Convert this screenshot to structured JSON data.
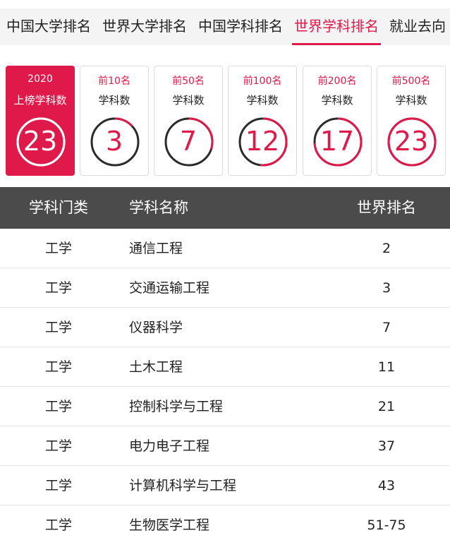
{
  "tabs": [
    {
      "label": "中国大学排名",
      "active": false
    },
    {
      "label": "世界大学排名",
      "active": false
    },
    {
      "label": "中国学科排名",
      "active": false
    },
    {
      "label": "世界学科排名",
      "active": true
    },
    {
      "label": "就业去向",
      "active": false
    }
  ],
  "cards": [
    {
      "line1": "2020",
      "line2": "上榜学科数",
      "value": "23",
      "highlight": true,
      "fraction": 1.0
    },
    {
      "line1": "前10名",
      "line2": "学科数",
      "value": "3",
      "highlight": false,
      "fraction": 0.13
    },
    {
      "line1": "前50名",
      "line2": "学科数",
      "value": "7",
      "highlight": false,
      "fraction": 0.3
    },
    {
      "line1": "前100名",
      "line2": "学科数",
      "value": "12",
      "highlight": false,
      "fraction": 0.52
    },
    {
      "line1": "前200名",
      "line2": "学科数",
      "value": "17",
      "highlight": false,
      "fraction": 0.74
    },
    {
      "line1": "前500名",
      "line2": "学科数",
      "value": "23",
      "highlight": false,
      "fraction": 1.0
    }
  ],
  "table": {
    "headers": [
      "学科门类",
      "学科名称",
      "世界排名"
    ],
    "rows": [
      [
        "工学",
        "通信工程",
        "2"
      ],
      [
        "工学",
        "交通运输工程",
        "3"
      ],
      [
        "工学",
        "仪器科学",
        "7"
      ],
      [
        "工学",
        "土木工程",
        "11"
      ],
      [
        "工学",
        "控制科学与工程",
        "21"
      ],
      [
        "工学",
        "电力电子工程",
        "37"
      ],
      [
        "工学",
        "计算机科学与工程",
        "43"
      ],
      [
        "工学",
        "生物医学工程",
        "51-75"
      ]
    ]
  },
  "colors": {
    "accent": "#e0194b",
    "ring_track": "#2b2b2b",
    "header_bg": "#4b4b4b",
    "tabbar_bg": "#f4f4f4"
  }
}
